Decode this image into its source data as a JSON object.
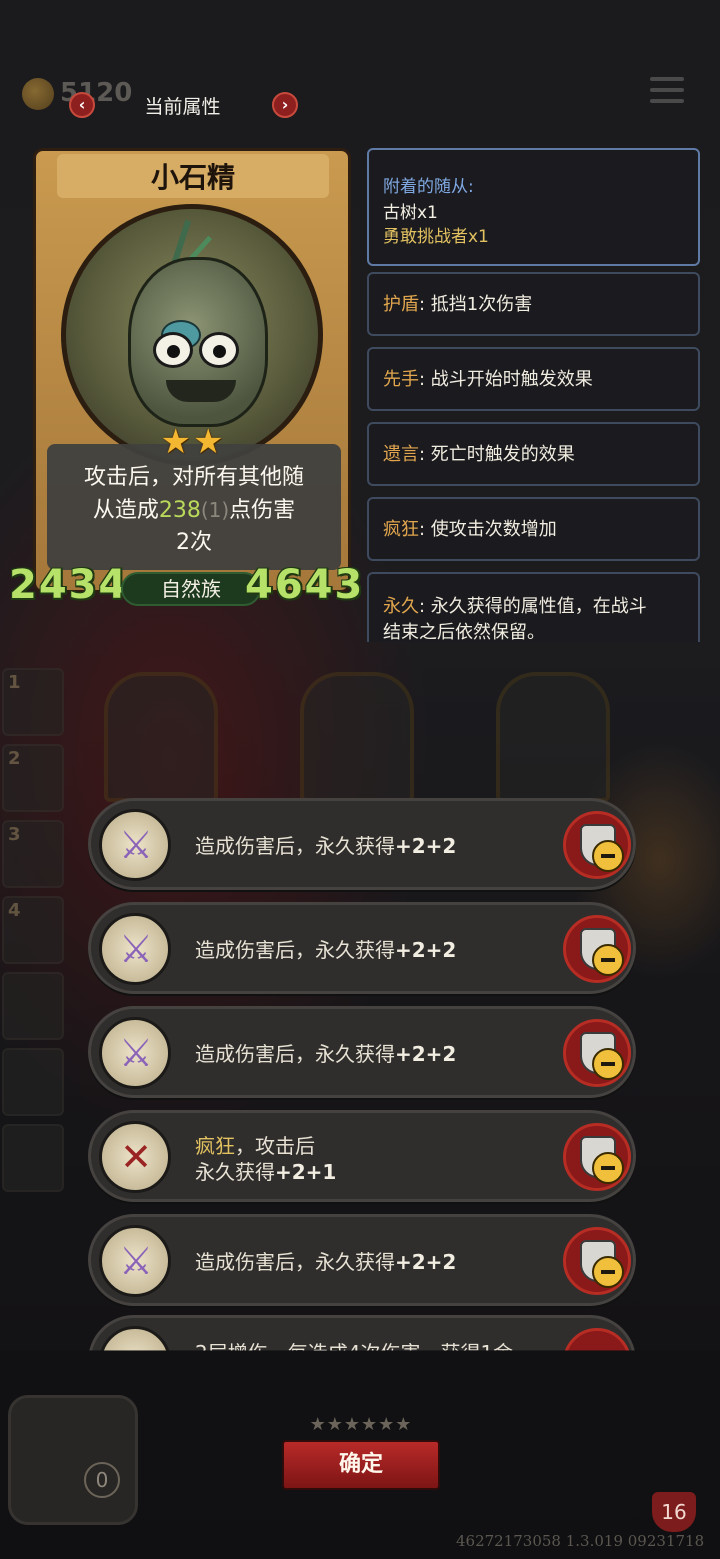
{
  "header": {
    "coins": "5120",
    "title": "当前属性",
    "prev_label": "‹",
    "next_label": "›"
  },
  "card": {
    "name": "小石精",
    "stars": "★★",
    "desc_line1": "攻击后，对所有其他随",
    "desc_line2_pre": "从造成",
    "desc_value": "238",
    "desc_sub": "(1)",
    "desc_line2_post": "点伤害",
    "desc_line3": "2次",
    "attack": "2434",
    "health": "4643",
    "race": "自然族"
  },
  "attached": {
    "heading": "附着的随从:",
    "items": [
      "古树x1",
      "勇敢挑战者x1"
    ]
  },
  "keywords": [
    {
      "key": "护盾",
      "text": ": 抵挡1次伤害"
    },
    {
      "key": "先手",
      "text": ": 战斗开始时触发效果"
    },
    {
      "key": "遗言",
      "text": ": 死亡时触发的效果"
    },
    {
      "key": "疯狂",
      "text": ": 使攻击次数增加"
    },
    {
      "key": "永久",
      "text": ": 永久获得的属性值，在战斗",
      "text2": "结束之后依然保留。"
    }
  ],
  "buffs": [
    {
      "text": "造成伤害后，永久获得",
      "plus": "+2+2",
      "icon": "cursed-sword-icon"
    },
    {
      "text": "造成伤害后，永久获得",
      "plus": "+2+2",
      "icon": "cursed-sword-icon"
    },
    {
      "text": "造成伤害后，永久获得",
      "plus": "+2+2",
      "icon": "cursed-sword-icon"
    },
    {
      "kw": "疯狂",
      "text": "，攻击后",
      "text2": "永久获得",
      "plus": "+2+1",
      "icon": "crossed-swords-icon"
    },
    {
      "text": "造成伤害后，永久获得",
      "plus": "+2+2",
      "icon": "cursed-sword-icon"
    }
  ],
  "buff_partial": "2层增伤，每造成4次伤害，获得1金",
  "footer": {
    "confirm": "确定",
    "stars": "★★★★★★",
    "chest_count": "0",
    "level": "16",
    "build_code": "46272173058 1.3.019 09231718"
  },
  "roster_numbers": [
    "1",
    "2",
    "3",
    "4"
  ],
  "colors": {
    "stat_green": "#b6e26a",
    "keyword_gold": "#e2a64e",
    "attached_blue": "#7fa7e0",
    "confirm_red": "#b82a28"
  }
}
